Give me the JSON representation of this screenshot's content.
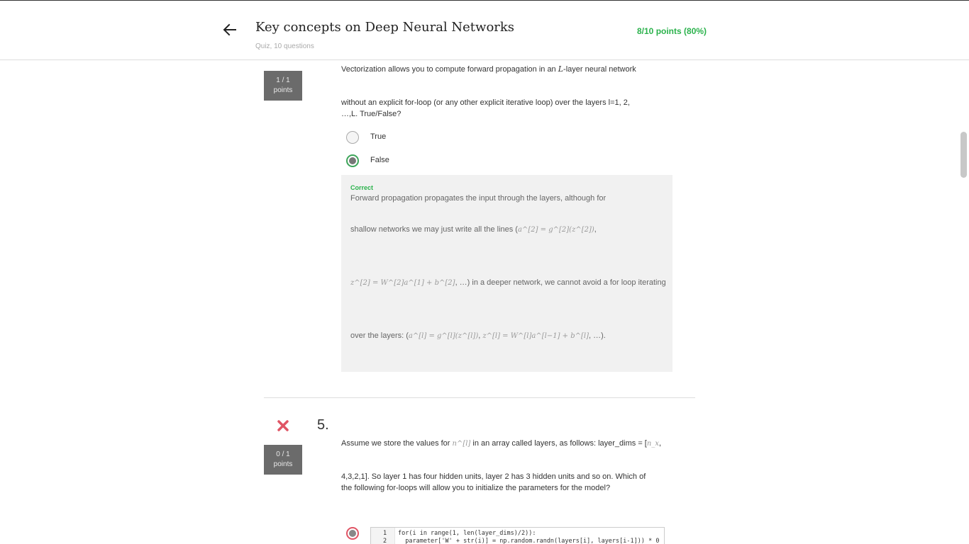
{
  "header": {
    "title": "Key concepts on Deep Neural Networks",
    "subtitle": "Quiz, 10 questions",
    "score": "8/10 points (80%)"
  },
  "q4": {
    "points_value": "1 / 1",
    "points_label": "points",
    "text_1a": "Vectorization allows you to compute forward propagation in an ",
    "math_L": "L",
    "text_1b": "-layer neural network",
    "text_2": "without an explicit for-loop (or any other explicit iterative loop) over the layers l=1, 2,",
    "text_3": "…,L. True/False?",
    "options": [
      {
        "label": "True",
        "selected": false
      },
      {
        "label": "False",
        "selected": true
      }
    ],
    "feedback": {
      "status": "Correct",
      "line_1": "Forward propagation propagates the input through the layers, although for",
      "line_2_text": "shallow networks we may just write all the lines (",
      "line_2_math": "a^[2] = g^[2](z^[2])",
      "line_2_end": ",",
      "line_3_math": "z^[2] = W^[2]a^[1] + b^[2]",
      "line_3_text": ", …) in a deeper network, we cannot avoid a for loop iterating",
      "line_4_text": "over the layers: (",
      "line_4_math_1": "a^[l] = g^[l](z^[l])",
      "line_4_sep": ", ",
      "line_4_math_2": "z^[l] = W^[l]a^[l−1] + b^[l]",
      "line_4_end": ", …)."
    }
  },
  "q5": {
    "number": "5.",
    "points_value": "0 / 1",
    "points_label": "points",
    "status": "incorrect",
    "text_1a": "Assume we store the values for ",
    "math_n": "n^[l]",
    "text_1b": " in an array called layers, as follows: layer_dims = [",
    "math_nx": "n_x",
    "text_1c": ",",
    "text_2": "4,3,2,1]. So layer 1 has four hidden units, layer 2 has 3 hidden units and so on. Which of",
    "text_3": "the following for-loops will allow you to initialize the parameters for the model?",
    "code": {
      "line_1_no": "1",
      "line_2_no": "2",
      "line_1": "for(i in range(1, len(layer_dims)/2)):",
      "line_2": "  parameter['W' + str(i)] = np.random.randn(layers[i], layers[i-1])) * 0"
    }
  },
  "colors": {
    "correct_green": "#2bb24c",
    "incorrect_red": "#e05565",
    "points_box": "#6b6b6b"
  }
}
